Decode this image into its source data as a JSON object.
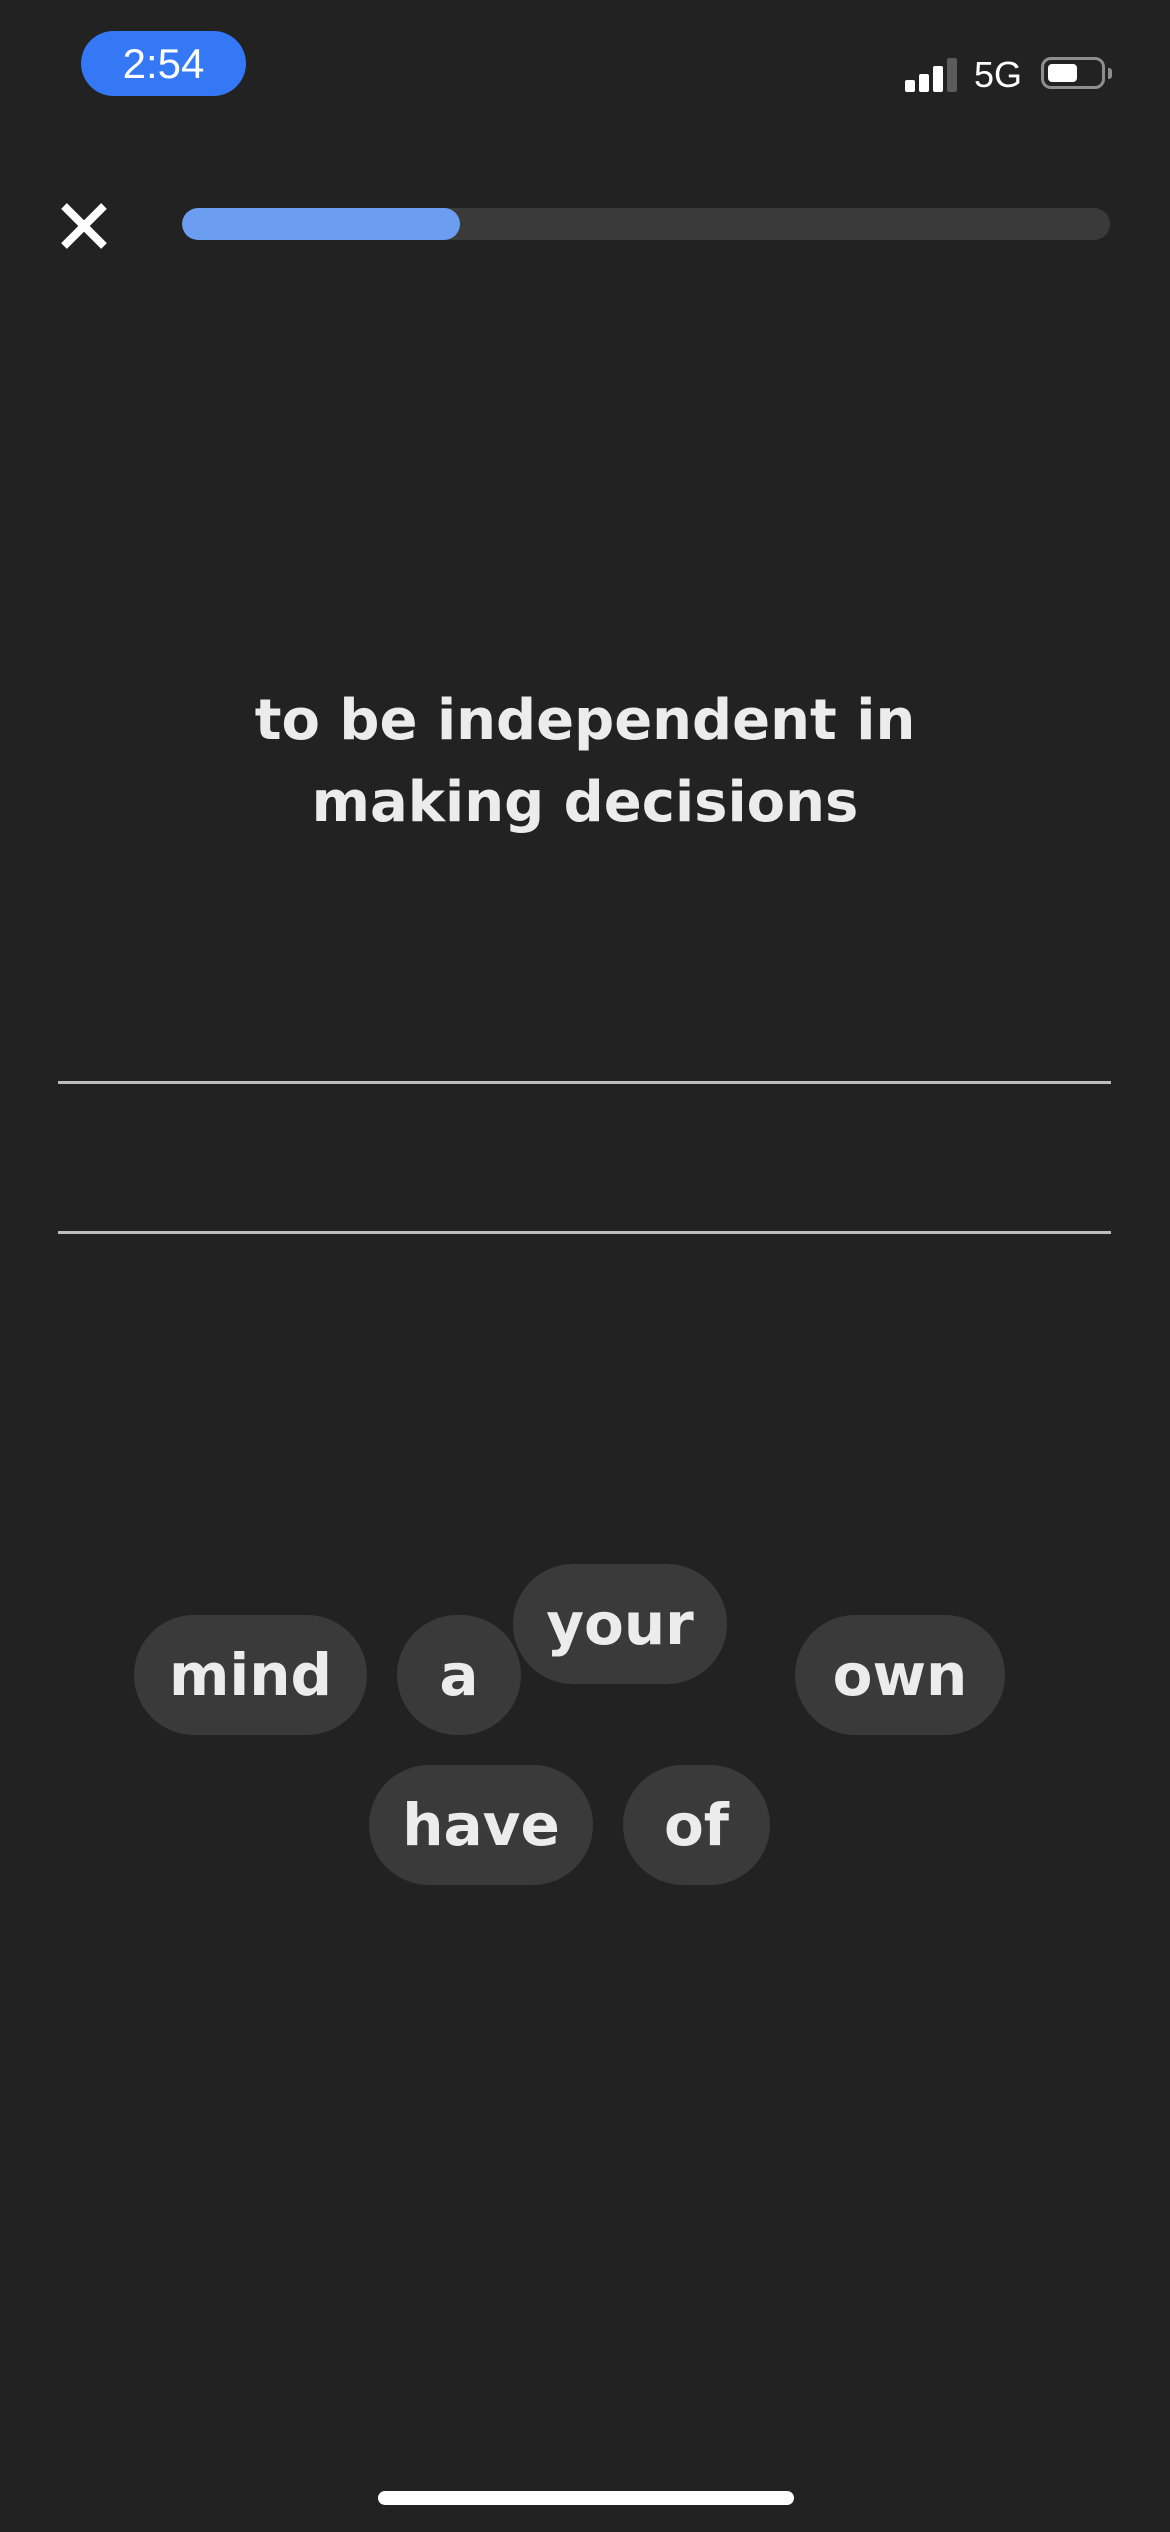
{
  "status_bar": {
    "time": "2:54",
    "network": "5G",
    "signal_bars_active": 3,
    "signal_bars_total": 4,
    "battery_level": 0.5,
    "time_pill_color": "#3478f6"
  },
  "top_bar": {
    "close_icon": "close-x-icon",
    "progress": 0.3,
    "progress_color": "#6b9ef0",
    "track_color": "#3a3a3a"
  },
  "prompt": {
    "line1": "to be independent in",
    "line2": "making decisions"
  },
  "word_bank": {
    "words": [
      "mind",
      "a",
      "your",
      "own",
      "have",
      "of"
    ]
  },
  "colors": {
    "background": "#222222",
    "chip_background": "#3a3a3a",
    "text": "#ececec"
  }
}
